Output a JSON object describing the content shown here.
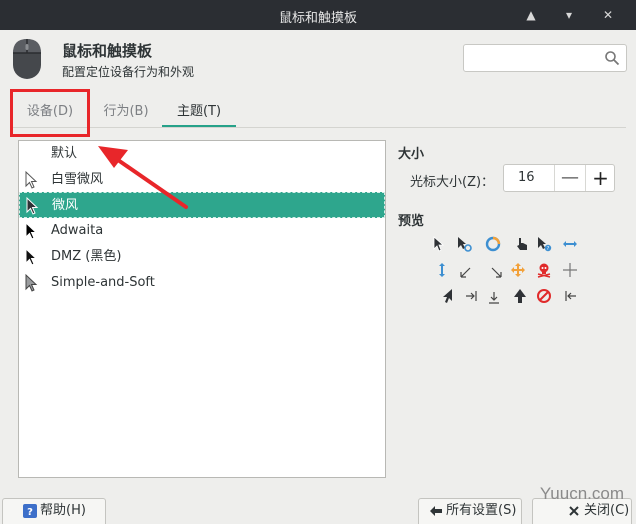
{
  "window": {
    "title": "鼠标和触摸板",
    "controls": [
      "▲",
      "▾",
      "✕"
    ]
  },
  "header": {
    "title": "鼠标和触摸板",
    "subtitle": "配置定位设备行为和外观",
    "search_placeholder": ""
  },
  "tabs": [
    {
      "label": "设备(D)",
      "active": false
    },
    {
      "label": "行为(B)",
      "active": false
    },
    {
      "label": "主题(T)",
      "active": true
    }
  ],
  "themes": [
    {
      "label": "默认",
      "icon": "none-icon",
      "selected": false
    },
    {
      "label": "白雪微风",
      "icon": "white-arrow-cursor-icon",
      "selected": false
    },
    {
      "label": "微风",
      "icon": "dark-arrow-cursor-icon",
      "selected": true
    },
    {
      "label": "Adwaita",
      "icon": "black-arrow-cursor-icon",
      "selected": false
    },
    {
      "label": "DMZ (黑色)",
      "icon": "black-arrow-cursor-icon",
      "selected": false
    },
    {
      "label": "Simple-and-Soft",
      "icon": "grey-arrow-cursor-icon",
      "selected": false
    }
  ],
  "size": {
    "title": "大小",
    "label": "光标大小(Z)：",
    "value": "16",
    "minus": "—",
    "plus": "+"
  },
  "preview": {
    "title": "预览"
  },
  "footer": {
    "help": "帮助(H)",
    "all_settings": "所有设置(S)",
    "close": "关闭(C)"
  },
  "watermark": "Yuucn.com",
  "colors": {
    "accent": "#26a189",
    "selection": "#2ea68d",
    "annotation": "#e8262a",
    "titlebar": "#2b2e33"
  }
}
